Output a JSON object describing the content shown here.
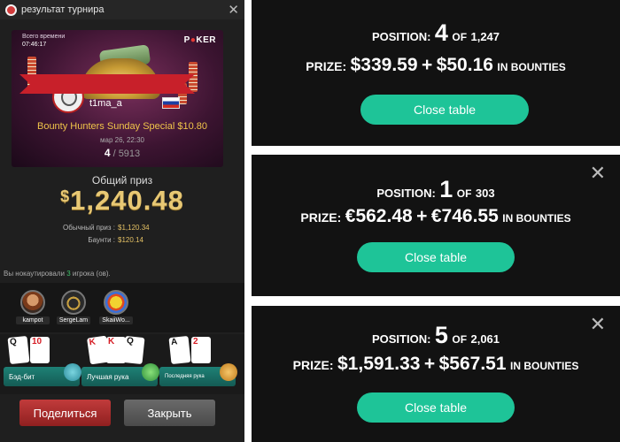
{
  "left_panel": {
    "header_title": "результат турнира",
    "banner": {
      "time_label": "Всего времени",
      "time_value": "07:46:17",
      "brand": {
        "pre": "P",
        "mid": "K",
        "post": "ER"
      },
      "player_name": "t1ma_a"
    },
    "tournament_name": "Bounty Hunters Sunday Special $10.80",
    "date": "мар 26, 22:30",
    "position": "4",
    "entrants": "5913",
    "total_prize_label": "Общий приз",
    "total_prize_currency": "$",
    "total_prize_value": "1,240.48",
    "regular_prize_label": "Обычный приз :",
    "regular_prize_value": "$1,120.34",
    "bounty_label": "Баунти :",
    "bounty_value": "$120.14",
    "knockout_pre": "Вы нокаутировали ",
    "knockout_count": "3",
    "knockout_post": " игрока (ов).",
    "knocked_players": [
      {
        "name": "kampot"
      },
      {
        "name": "SergeLam"
      },
      {
        "name": "SkaiiWo..."
      }
    ],
    "hands": [
      {
        "label": "Бэд-бит",
        "cards": [
          "Q",
          "10"
        ]
      },
      {
        "label": "Лучшая рука",
        "cards": [
          "K",
          "K",
          "Q"
        ]
      },
      {
        "label": "Последняя рука",
        "cards": [
          "A",
          "2"
        ]
      }
    ],
    "share_button": "Поделиться",
    "close_button": "Закрыть"
  },
  "results": [
    {
      "position_label": "POSITION:",
      "position": "4",
      "of_label": "OF",
      "total": "1,247",
      "prize_label": "PRIZE:",
      "prize": "$339.59",
      "plus": "+",
      "bounties": "$50.16",
      "bounties_label": "IN BOUNTIES",
      "close_label": "Close table"
    },
    {
      "position_label": "POSITION:",
      "position": "1",
      "of_label": "OF",
      "total": "303",
      "prize_label": "PRIZE:",
      "prize": "€562.48",
      "plus": "+",
      "bounties": "€746.55",
      "bounties_label": "IN BOUNTIES",
      "close_label": "Close table"
    },
    {
      "position_label": "POSITION:",
      "position": "5",
      "of_label": "OF",
      "total": "2,061",
      "prize_label": "PRIZE:",
      "prize": "$1,591.33",
      "plus": "+",
      "bounties": "$567.51",
      "bounties_label": "IN BOUNTIES",
      "close_label": "Close table"
    }
  ],
  "colors": {
    "accent_green": "#1ec498",
    "gold": "#e8c874",
    "ribbon_red": "#c8202a"
  }
}
